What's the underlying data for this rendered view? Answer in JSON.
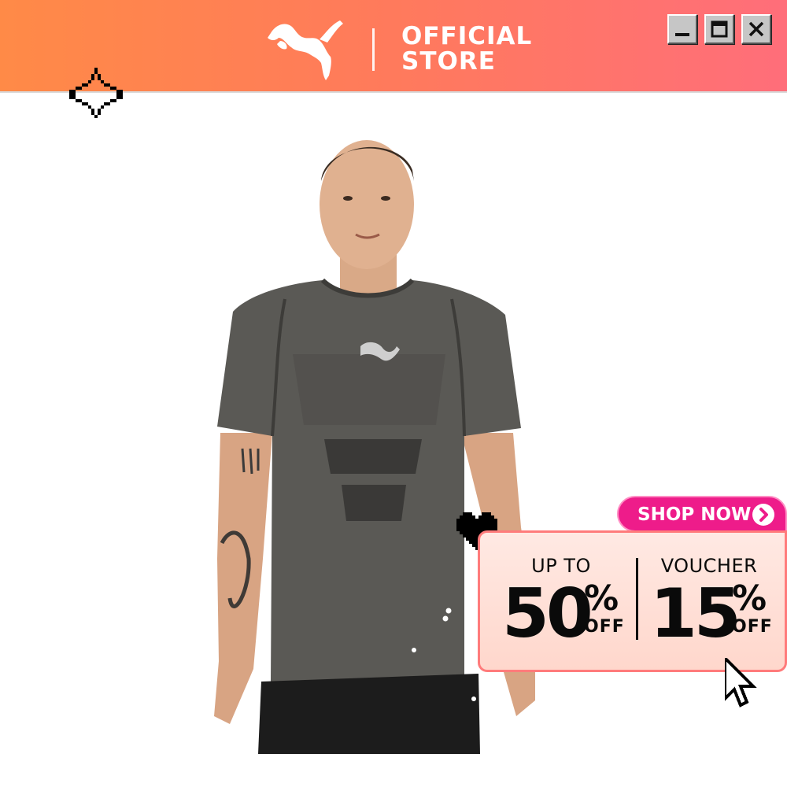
{
  "header": {
    "brand_logo": "puma-cat-logo",
    "store_line1": "OFFICIAL",
    "store_line2": "STORE",
    "window_controls": [
      "minimize",
      "maximize",
      "close"
    ]
  },
  "product": {
    "image": "model-wearing-grey-heather-puma-t-shirt"
  },
  "promo": {
    "shop_now_label": "SHOP NOW",
    "left": {
      "top": "UP TO",
      "value": "50",
      "percent": "%",
      "off": "OFF"
    },
    "right": {
      "top": "VOUCHER",
      "value": "15",
      "percent": "%",
      "off": "OFF"
    }
  },
  "colors": {
    "header_gradient_start": "#ff8a47",
    "header_gradient_end": "#ff6e7a",
    "shop_now_bg": "#ee1c8a",
    "promo_card_bg": "#ffe2da",
    "promo_card_border": "#ff7b7b",
    "shirt": "#5a5955"
  },
  "decor_icons": [
    "pixel-sparkle-icon",
    "pixel-heart-icon",
    "pixel-cursor-icon"
  ]
}
